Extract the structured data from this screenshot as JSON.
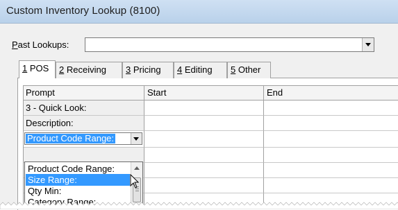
{
  "window": {
    "title": "Custom Inventory Lookup (8100)"
  },
  "past_lookups": {
    "label_mnemonic": "P",
    "label_rest": "ast Lookups:",
    "value": ""
  },
  "tabs": [
    {
      "num": "1",
      "label": " POS",
      "active": true
    },
    {
      "num": "2",
      "label": " Receiving",
      "active": false
    },
    {
      "num": "3",
      "label": " Pricing",
      "active": false
    },
    {
      "num": "4",
      "label": " Editing",
      "active": false
    },
    {
      "num": "5",
      "label": " Other",
      "active": false
    }
  ],
  "grid": {
    "headers": [
      "Prompt",
      "Start",
      "End"
    ],
    "rows": [
      {
        "prompt": "3 - Quick Look:",
        "start": "",
        "end": ""
      },
      {
        "prompt": "Description:",
        "start": "",
        "end": ""
      },
      {
        "prompt": "Product Code Range:",
        "start": "",
        "end": ""
      }
    ]
  },
  "dropdown": {
    "items": [
      "Product Code Range:",
      "Size Range:",
      "Qty Min:",
      "Category Range:"
    ],
    "selected_index": 1
  }
}
